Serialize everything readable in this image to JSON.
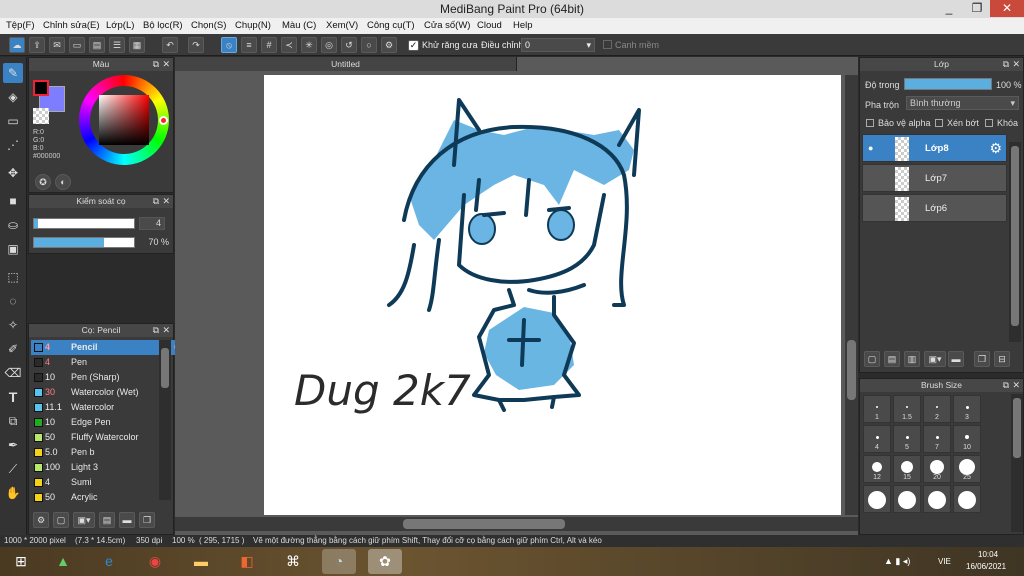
{
  "window": {
    "title": "MediBang Paint Pro (64bit)",
    "controls": [
      "_",
      "❐",
      "✕"
    ]
  },
  "menu": [
    "Tệp(F)",
    "Chỉnh sửa(E)",
    "Lớp(L)",
    "Bộ lọc(R)",
    "Chọn(S)",
    "Chụp(N)",
    "Màu (C)",
    "Xem(V)",
    "Công cụ(T)",
    "Cửa số(W)",
    "Cloud",
    "Help"
  ],
  "toolbar": {
    "antialias_label": "Khử răng cưa",
    "adjust_label": "Điều chỉnh",
    "adjust_value": "0",
    "edge_label": "Canh mềm"
  },
  "color_panel": {
    "title": "Màu",
    "r": "R:0",
    "g": "G:0",
    "b": "B:0",
    "hex": "#000000",
    "primary": "#000000",
    "secondary": "#7d7dff"
  },
  "brush_control": {
    "title": "Kiểm soát cọ",
    "size": "4",
    "opacity": "70 %",
    "opacity_fraction": 0.7,
    "size_fraction": 0.04
  },
  "brush_panel": {
    "title": "Cọ: Pencil",
    "brushes": [
      {
        "num": "4",
        "name": "Pencil",
        "color": "#3b82c4",
        "selected": true
      },
      {
        "num": "4",
        "name": "Pen",
        "color": "#2b2b2b"
      },
      {
        "num": "10",
        "name": "Pen (Sharp)",
        "color": "#2b2b2b"
      },
      {
        "num": "30",
        "name": "Watercolor (Wet)",
        "color": "#59c3f0"
      },
      {
        "num": "11.1",
        "name": "Watercolor",
        "color": "#59c3f0"
      },
      {
        "num": "10",
        "name": "Edge Pen",
        "color": "#22aa22"
      },
      {
        "num": "50",
        "name": "Fluffy Watercolor",
        "color": "#b8e86a"
      },
      {
        "num": "5.0",
        "name": " Pen b",
        "color": "#f2d21a"
      },
      {
        "num": "100",
        "name": "Light 3",
        "color": "#b8e86a"
      },
      {
        "num": "4",
        "name": "Sumi",
        "color": "#f2d21a"
      },
      {
        "num": "50",
        "name": "Acrylic",
        "color": "#f2d21a"
      }
    ]
  },
  "document": {
    "tab": "Untitled",
    "signature": "Dug 2k7"
  },
  "layers_panel": {
    "title": "Lớp",
    "opacity_label": "Độ trong",
    "opacity_value": "100 %",
    "blend_label": "Pha trộn",
    "blend_value": "Bình thường",
    "protect_alpha": "Bảo vệ alpha",
    "clipping": "Xén bớt",
    "lock": "Khóa",
    "layers": [
      {
        "name": "Lớp8",
        "selected": true
      },
      {
        "name": "Lớp7",
        "selected": false
      },
      {
        "name": "Lớp6",
        "selected": false
      }
    ]
  },
  "brush_size_panel": {
    "title": "Brush Size",
    "sizes": [
      "1",
      "1.5",
      "2",
      "3",
      "4",
      "5",
      "7",
      "10",
      "12",
      "15",
      "20",
      "25",
      "",
      "",
      "",
      ""
    ]
  },
  "status": {
    "size": "1000 * 2000 pixel",
    "cm": "(7.3 * 14.5cm)",
    "dpi": "350 dpi",
    "zoom": "100 %",
    "coords": "( 295, 1715 )",
    "hint": "Vẽ một đường thẳng bằng cách giữ phím Shift, Thay đổi cỡ cọ bằng cách giữ phím Ctrl, Alt và kéo"
  },
  "taskbar": {
    "lang": "VIE",
    "time": "10:04",
    "date": "16/06/2021"
  },
  "colors": {
    "accent": "#3b82c4",
    "sketch": "#5aaee0",
    "line": "#0e3a57"
  }
}
